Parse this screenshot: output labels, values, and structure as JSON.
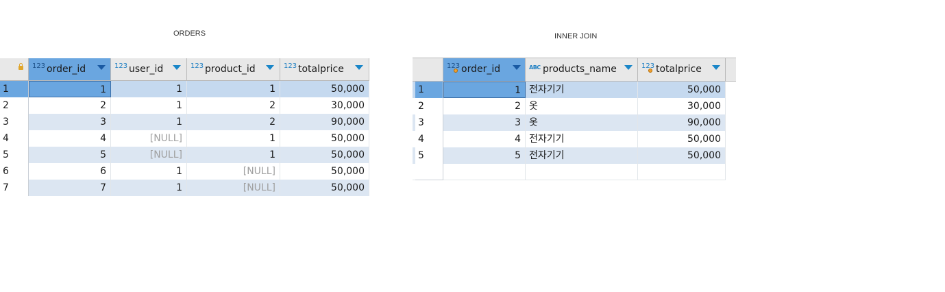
{
  "left": {
    "caption": "ORDERS",
    "columns": [
      {
        "type": "123",
        "name": "order_id"
      },
      {
        "type": "123",
        "name": "user_id"
      },
      {
        "type": "123",
        "name": "product_id"
      },
      {
        "type": "123",
        "name": "totalprice"
      }
    ],
    "rows": [
      [
        "1",
        "1",
        "1",
        "1",
        "50,000"
      ],
      [
        "2",
        "2",
        "1",
        "2",
        "30,000"
      ],
      [
        "3",
        "3",
        "1",
        "2",
        "90,000"
      ],
      [
        "4",
        "4",
        "[NULL]",
        "1",
        "50,000"
      ],
      [
        "5",
        "5",
        "[NULL]",
        "1",
        "50,000"
      ],
      [
        "6",
        "6",
        "1",
        "[NULL]",
        "50,000"
      ],
      [
        "7",
        "7",
        "1",
        "[NULL]",
        "50,000"
      ]
    ]
  },
  "right": {
    "caption": "INNER JOIN",
    "columns": [
      {
        "type": "123",
        "name": "order_id"
      },
      {
        "type": "ABC",
        "name": "products_name"
      },
      {
        "type": "123",
        "name": "totalprice"
      }
    ],
    "rows": [
      [
        "1",
        "1",
        "전자기기",
        "50,000"
      ],
      [
        "2",
        "2",
        "옷",
        "30,000"
      ],
      [
        "3",
        "3",
        "옷",
        "90,000"
      ],
      [
        "4",
        "4",
        "전자기기",
        "50,000"
      ],
      [
        "5",
        "5",
        "전자기기",
        "50,000"
      ]
    ]
  },
  "colors": {
    "selected_cell": "#6aa6e0",
    "selected_row": "#c5d9ef",
    "striped_row": "#dce6f2",
    "header_bg": "#e8e8e8",
    "null_text": "#a0a0a0"
  }
}
